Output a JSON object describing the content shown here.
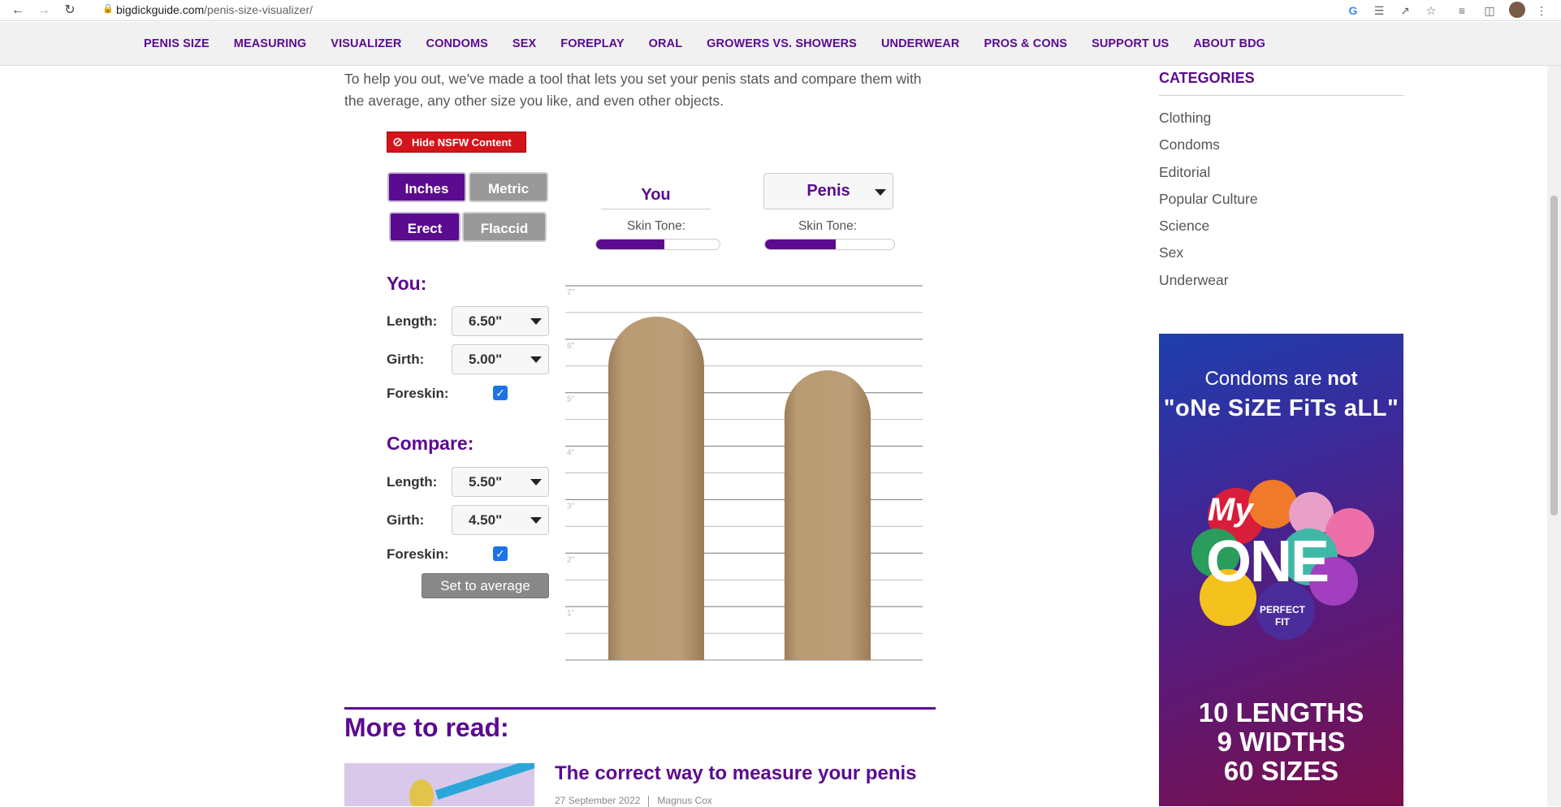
{
  "browser": {
    "url_domain": "bigdickguide.com",
    "url_path": "/penis-size-visualizer/"
  },
  "nav": [
    "PENIS SIZE",
    "MEASURING",
    "VISUALIZER",
    "CONDOMS",
    "SEX",
    "FOREPLAY",
    "ORAL",
    "GROWERS VS. SHOWERS",
    "UNDERWEAR",
    "PROS & CONS",
    "SUPPORT US",
    "ABOUT BDG"
  ],
  "intro": "To help you out, we've made a tool that lets you set your penis stats and compare them with the average, any other size you like, and even other objects.",
  "tool": {
    "nsfw_label": "Hide NSFW Content",
    "unit_inches": "Inches",
    "unit_metric": "Metric",
    "state_erect": "Erect",
    "state_flaccid": "Flaccid",
    "selected_unit": "Inches",
    "selected_state": "Erect",
    "col_you": "You",
    "col_compare": "Penis",
    "skin_tone_label": "Skin Tone:",
    "skin_tone_you": 0.55,
    "skin_tone_compare": 0.55,
    "you": {
      "title": "You:",
      "length_label": "Length:",
      "length": "6.50\"",
      "girth_label": "Girth:",
      "girth": "5.00\"",
      "foreskin_label": "Foreskin:",
      "foreskin": true
    },
    "compare": {
      "title": "Compare:",
      "length_label": "Length:",
      "length": "5.50\"",
      "girth_label": "Girth:",
      "girth": "4.50\"",
      "foreskin_label": "Foreskin:",
      "foreskin": true
    },
    "average_button": "Set to average",
    "color_accent": "#5b0b8f",
    "color_shape": "#b99b73"
  },
  "chart_data": {
    "type": "bar",
    "categories": [
      "You",
      "Penis"
    ],
    "series": [
      {
        "name": "Length",
        "values": [
          6.5,
          5.5
        ]
      },
      {
        "name": "Girth",
        "values": [
          5.0,
          4.5
        ]
      }
    ],
    "tick_labels": [
      "1\"",
      "2\"",
      "3\"",
      "4\"",
      "5\"",
      "6\"",
      "7\""
    ],
    "ylim": [
      0,
      7
    ],
    "unit": "inches"
  },
  "more": {
    "title": "More to read:",
    "article_title": "The correct way to measure your penis",
    "article_date": "27 September 2022",
    "article_author": "Magnus Cox"
  },
  "sidebar": {
    "title": "CATEGORIES",
    "items": [
      "Clothing",
      "Condoms",
      "Editorial",
      "Popular Culture",
      "Science",
      "Sex",
      "Underwear"
    ]
  },
  "ad": {
    "line1_a": "Condoms are ",
    "line1_b": "not",
    "line2": "\"oNe SiZE FiTs aLL\"",
    "logo_my": "My",
    "logo_one": "ONE",
    "logo_pf": "PERFECT FIT",
    "line3": "10 LENGTHS",
    "line4": "9 WIDTHS",
    "line5": "60 SIZES"
  }
}
